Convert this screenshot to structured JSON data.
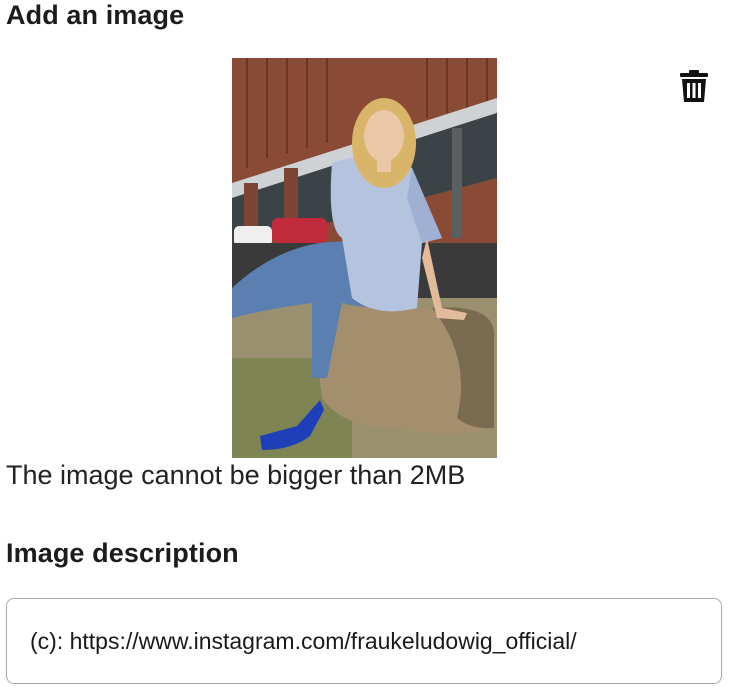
{
  "add_image": {
    "title": "Add an image",
    "hint": "The image cannot be bigger than 2MB",
    "delete_icon": "trash-icon"
  },
  "description": {
    "title": "Image description",
    "value": "(c): https://www.instagram.com/fraukeludowig_official/"
  },
  "colors": {
    "text": "#1c1c1c",
    "input_border": "#a9a9a9",
    "icon": "#111111"
  }
}
